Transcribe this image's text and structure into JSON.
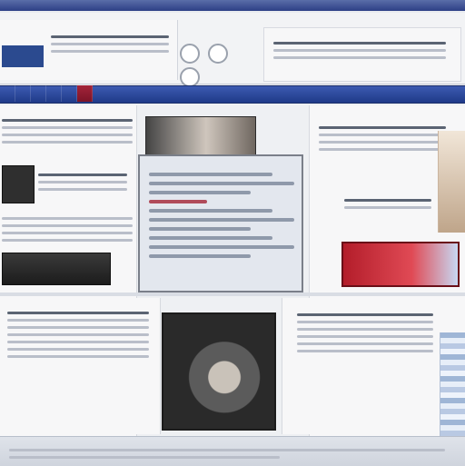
{
  "nav": {
    "items": [
      {
        "label": ""
      },
      {
        "label": ""
      },
      {
        "label": ""
      },
      {
        "label": ""
      },
      {
        "label": ""
      },
      {
        "label": ""
      }
    ]
  },
  "colors": {
    "nav_blue": "#2d3f86",
    "accent_red": "#b31d2a",
    "bg": "#e9ebef"
  },
  "icons": {
    "header_circles": [
      "circle-icon",
      "circle-icon",
      "circle-icon"
    ]
  }
}
